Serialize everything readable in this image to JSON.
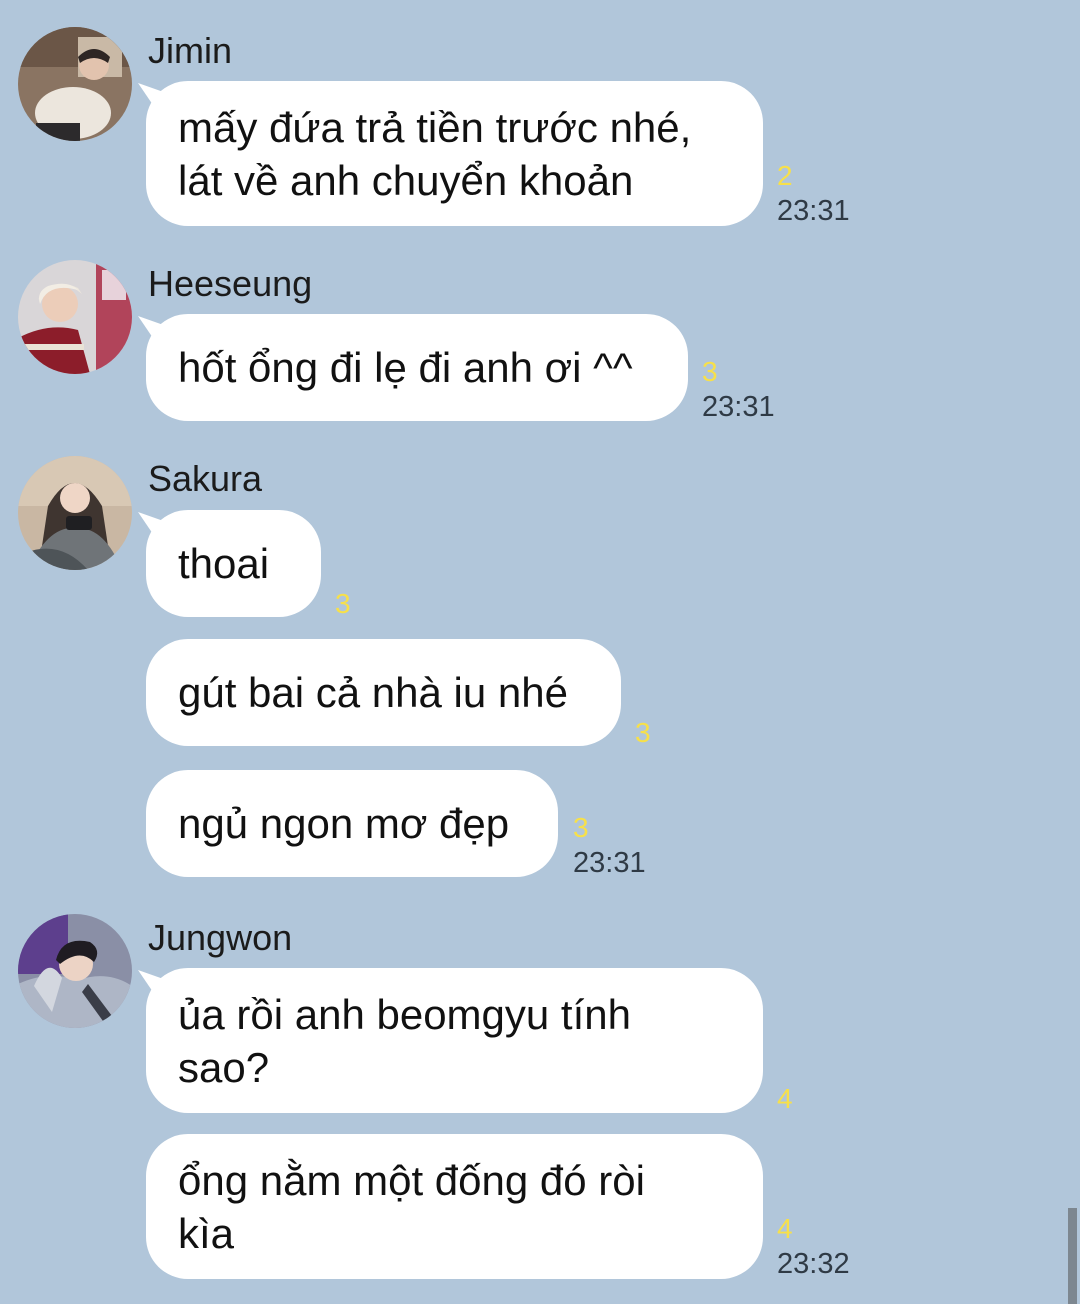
{
  "messages": [
    {
      "sender": "Jimin",
      "avatar": "jimin-avatar",
      "bubbles": [
        {
          "lines": [
            "mấy đứa trả tiền trước nhé,",
            "lát về anh chuyển khoản"
          ],
          "unread": "2",
          "time": "23:31"
        }
      ]
    },
    {
      "sender": "Heeseung",
      "avatar": "heeseung-avatar",
      "bubbles": [
        {
          "lines": [
            "hốt ổng đi lẹ đi anh ơi ^^"
          ],
          "unread": "3",
          "time": "23:31"
        }
      ]
    },
    {
      "sender": "Sakura",
      "avatar": "sakura-avatar",
      "bubbles": [
        {
          "lines": [
            "thoai"
          ],
          "unread": "3"
        },
        {
          "lines": [
            "gút bai cả nhà iu nhé"
          ],
          "unread": "3"
        },
        {
          "lines": [
            "ngủ ngon mơ đẹp"
          ],
          "unread": "3",
          "time": "23:31"
        }
      ]
    },
    {
      "sender": "Jungwon",
      "avatar": "jungwon-avatar",
      "bubbles": [
        {
          "lines": [
            "ủa rồi anh beomgyu tính",
            "sao?"
          ],
          "unread": "4"
        },
        {
          "lines": [
            "ổng nằm một đống đó ròi",
            "kìa"
          ],
          "unread": "4",
          "time": "23:32"
        }
      ]
    }
  ],
  "colors": {
    "background": "#b1c6da",
    "bubble": "#ffffff",
    "unread": "#f7e04a",
    "time": "#2f3a45"
  }
}
